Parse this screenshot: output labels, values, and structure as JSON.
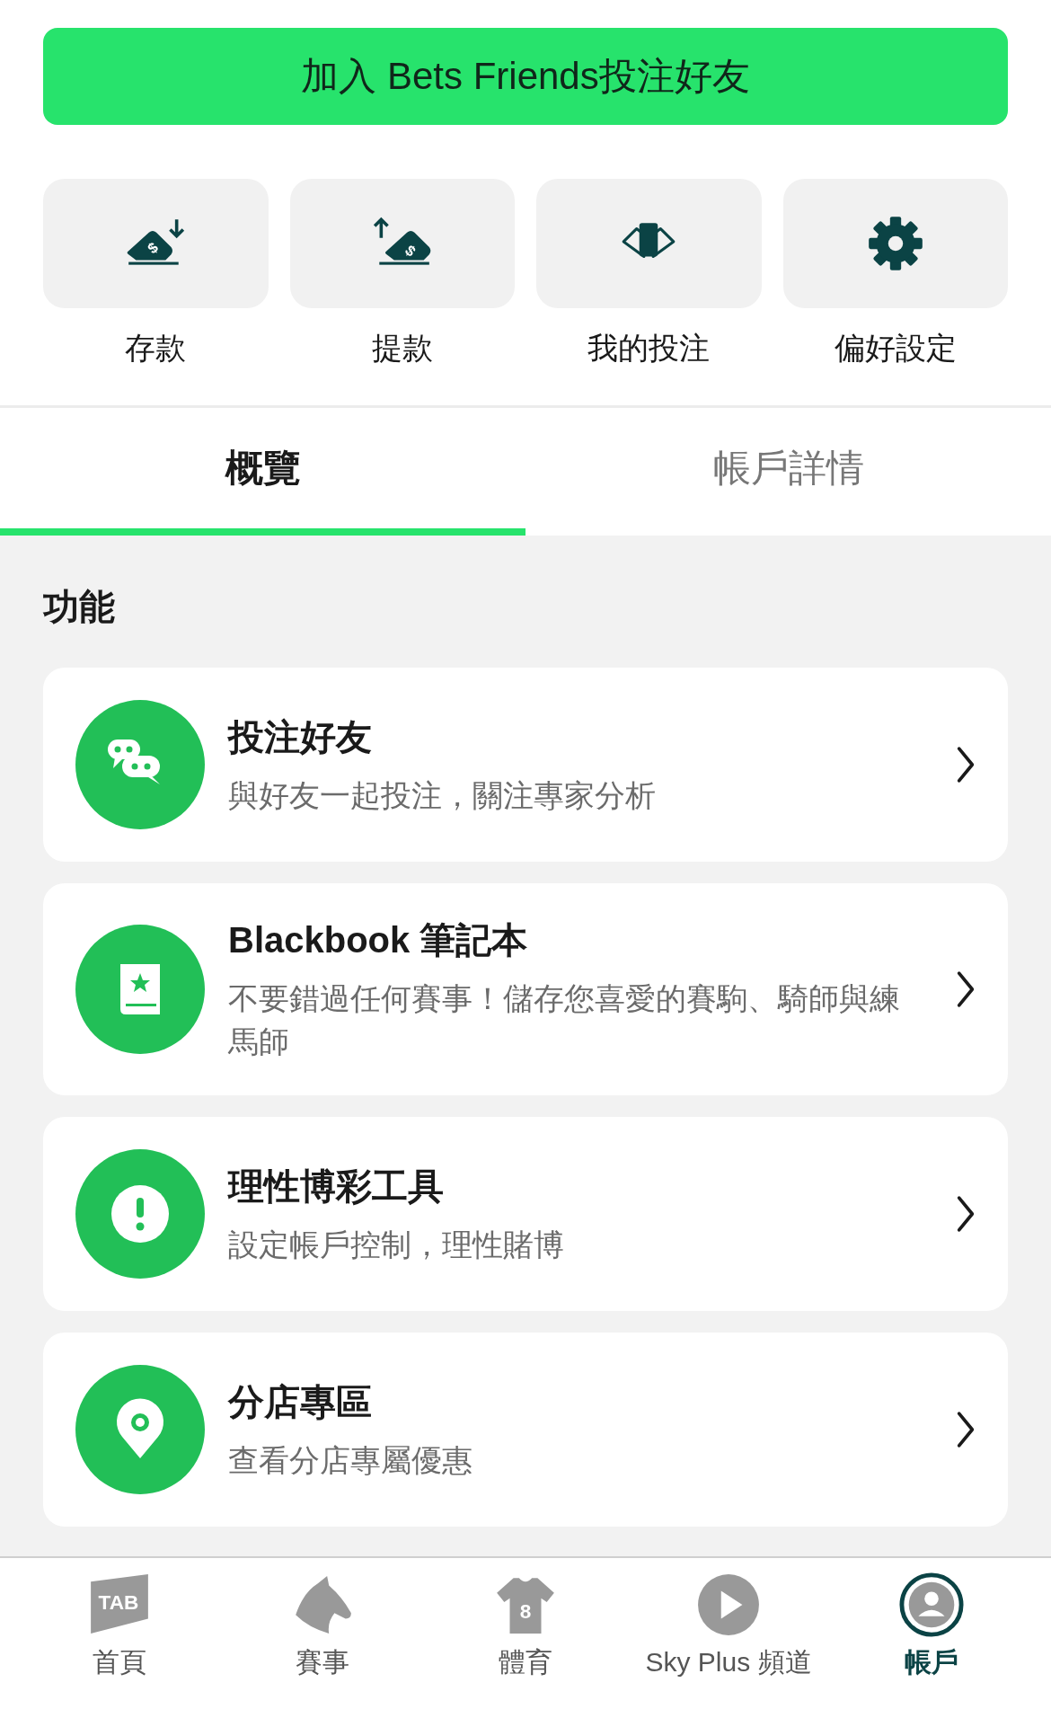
{
  "join_button": {
    "label": "加入 Bets Friends投注好友"
  },
  "quick_actions": [
    {
      "kind": "deposit",
      "label": "存款",
      "icon_text": "$"
    },
    {
      "kind": "withdraw",
      "label": "提款",
      "icon_text": "$"
    },
    {
      "kind": "bets",
      "label": "我的投注"
    },
    {
      "kind": "settings",
      "label": "偏好設定"
    }
  ],
  "tabs": [
    {
      "label": "概覽",
      "selected": true
    },
    {
      "label": "帳戶詳情",
      "selected": false
    }
  ],
  "section_title": "功能",
  "features": [
    {
      "kind": "chat",
      "title": "投注好友",
      "subtitle": "與好友一起投注，關注專家分析"
    },
    {
      "kind": "book",
      "title": "Blackbook 筆記本",
      "subtitle": "不要錯過任何賽事！儲存您喜愛的賽駒、騎師與練馬師"
    },
    {
      "kind": "alert",
      "title": "理性博彩工具",
      "subtitle": "設定帳戶控制，理性賭博"
    },
    {
      "kind": "pin",
      "title": "分店專區",
      "subtitle": "查看分店專屬優惠"
    }
  ],
  "bottom_nav": [
    {
      "kind": "home",
      "label": "首頁",
      "icon_text": "TAB",
      "selected": false
    },
    {
      "kind": "racing",
      "label": "賽事",
      "selected": false
    },
    {
      "kind": "sports",
      "label": "體育",
      "icon_text": "8",
      "selected": false
    },
    {
      "kind": "video",
      "label": "Sky Plus 頻道",
      "selected": false
    },
    {
      "kind": "account",
      "label": "帳戶",
      "selected": true
    }
  ]
}
